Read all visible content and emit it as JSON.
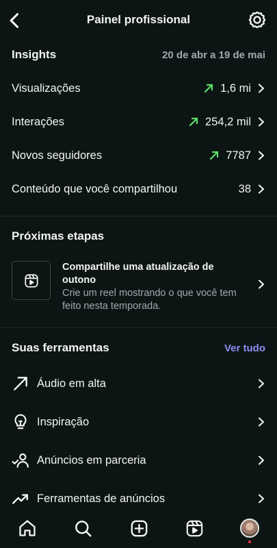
{
  "header": {
    "title": "Painel profissional"
  },
  "insights": {
    "title": "Insights",
    "date_range": "20 de abr a 19 de mai",
    "rows": [
      {
        "label": "Visualizações",
        "value": "1,6 mi",
        "trend": "up"
      },
      {
        "label": "Interações",
        "value": "254,2 mil",
        "trend": "up"
      },
      {
        "label": "Novos seguidores",
        "value": "7787",
        "trend": "up"
      },
      {
        "label": "Conteúdo que você compartilhou",
        "value": "38",
        "trend": ""
      }
    ]
  },
  "next_steps": {
    "title": "Próximas etapas",
    "card": {
      "title": "Compartilhe uma atualização de outono",
      "description": "Crie um reel mostrando o que você tem feito nesta temporada."
    }
  },
  "tools": {
    "title": "Suas ferramentas",
    "see_all": "Ver tudo",
    "items": [
      {
        "label": "Áudio em alta",
        "icon": "trending-arrow-icon"
      },
      {
        "label": "Inspiração",
        "icon": "lightbulb-icon"
      },
      {
        "label": "Anúncios em parceria",
        "icon": "partner-ads-icon"
      },
      {
        "label": "Ferramentas de anúncios",
        "icon": "chart-trend-icon"
      }
    ]
  },
  "tabbar": {
    "items": [
      "home-icon",
      "search-icon",
      "create-icon",
      "reels-icon",
      "profile-avatar"
    ]
  },
  "colors": {
    "background": "#0c1513",
    "trend_up": "#5ee06a",
    "link": "#8a8ef2",
    "muted": "#a2a9ad"
  }
}
